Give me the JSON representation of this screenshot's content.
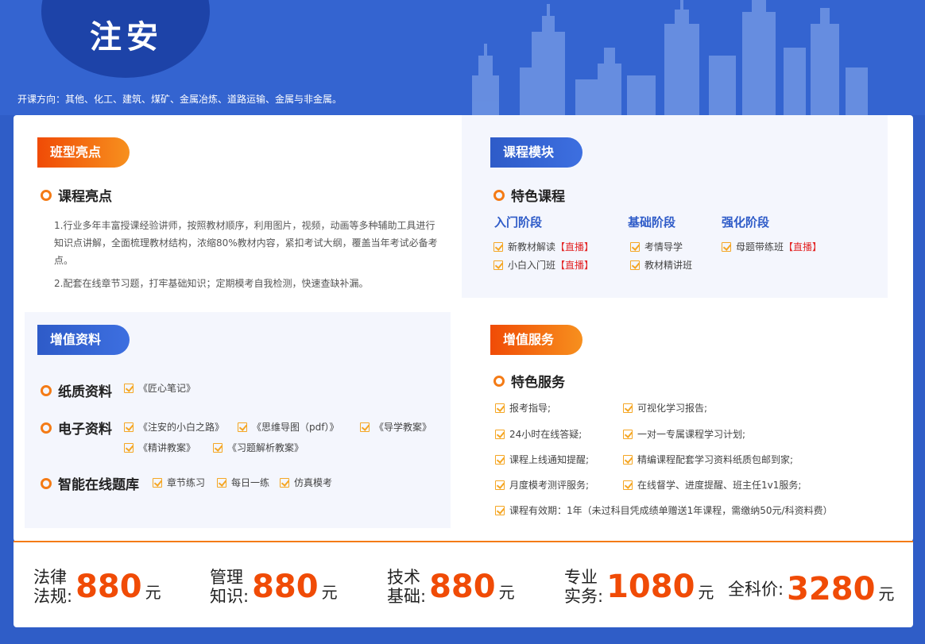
{
  "header": {
    "title": "注安",
    "direction": "开课方向：其他、化工、建筑、煤矿、金属冶炼、道路运输、金属与非金属。"
  },
  "highlights": {
    "pill": "班型亮点",
    "heading": "课程亮点",
    "para1": "1.行业多年丰富授课经验讲师，按照教材顺序，利用图片，视频，动画等多种辅助工具进行知识点讲解，全面梳理教材结构，浓缩80%教材内容，紧扣考试大纲，覆盖当年考试必备考点。",
    "para2": "2.配套在线章节习题，打牢基础知识；定期模考自我检测，快速查缺补漏。"
  },
  "modules": {
    "pill": "课程模块",
    "heading": "特色课程",
    "stages": [
      {
        "name": "入门阶段",
        "items": [
          {
            "text": "新教材解读",
            "tag": "【直播】"
          },
          {
            "text": "小白入门班",
            "tag": "【直播】"
          }
        ]
      },
      {
        "name": "基础阶段",
        "items": [
          {
            "text": "考情导学",
            "tag": ""
          },
          {
            "text": "教材精讲班",
            "tag": ""
          }
        ]
      },
      {
        "name": "强化阶段",
        "items": [
          {
            "text": "母题带练班",
            "tag": "【直播】"
          }
        ]
      }
    ]
  },
  "materials": {
    "pill": "增值资料",
    "paper_label": "纸质资料",
    "paper_items": [
      "《匠心笔记》"
    ],
    "digital_label": "电子资料",
    "digital_items": [
      "《注安的小白之路》",
      "《思维导图（pdf）》",
      "《导学教案》",
      "《精讲教案》",
      "《习题解析教案》"
    ],
    "bank_label": "智能在线题库",
    "bank_items": [
      "章节练习",
      "每日一练",
      "仿真模考"
    ]
  },
  "services": {
    "pill": "增值服务",
    "heading": "特色服务",
    "left": [
      "报考指导;",
      "24小时在线答疑;",
      "课程上线通知提醒;",
      "月度模考测评服务;"
    ],
    "right": [
      "可视化学习报告;",
      "一对一专属课程学习计划;",
      "精编课程配套学习资料纸质包邮到家;",
      "在线督学、进度提醒、班主任1v1服务;"
    ],
    "validity": "课程有效期：1年（未过科目凭成绩单赠送1年课程，需缴纳50元/科资料费）"
  },
  "prices": [
    {
      "line1": "法律",
      "line2": "法规",
      "value": "880",
      "unit": "元"
    },
    {
      "line1": "管理",
      "line2": "知识",
      "value": "880",
      "unit": "元"
    },
    {
      "line1": "技术",
      "line2": "基础",
      "value": "880",
      "unit": "元"
    },
    {
      "line1": "专业",
      "line2": "实务",
      "value": "1080",
      "unit": "元"
    },
    {
      "line1": "全科价",
      "line2": "",
      "value": "3280",
      "unit": "元"
    }
  ],
  "colors": {
    "brand_blue": "#2e5bc8",
    "accent_orange": "#f47b16",
    "price_red": "#f04b06",
    "live_red": "#e32929"
  }
}
